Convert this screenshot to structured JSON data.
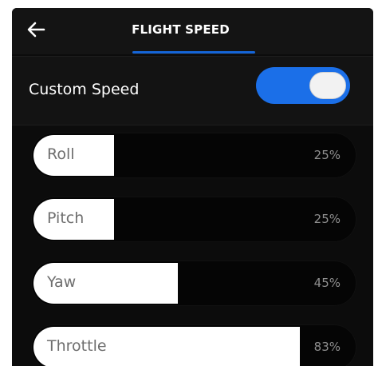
{
  "header": {
    "title": "FLIGHT SPEED",
    "back_icon": "back-arrow-icon"
  },
  "custom_speed": {
    "label": "Custom Speed",
    "enabled": true
  },
  "colors": {
    "accent": "#1b6fe8",
    "background": "#0c0c0c",
    "fill": "#ffffff"
  },
  "sliders": [
    {
      "label": "Roll",
      "value_text": "25%",
      "value": 25
    },
    {
      "label": "Pitch",
      "value_text": "25%",
      "value": 25
    },
    {
      "label": "Yaw",
      "value_text": "45%",
      "value": 45
    },
    {
      "label": "Throttle",
      "value_text": "83%",
      "value": 83
    }
  ]
}
